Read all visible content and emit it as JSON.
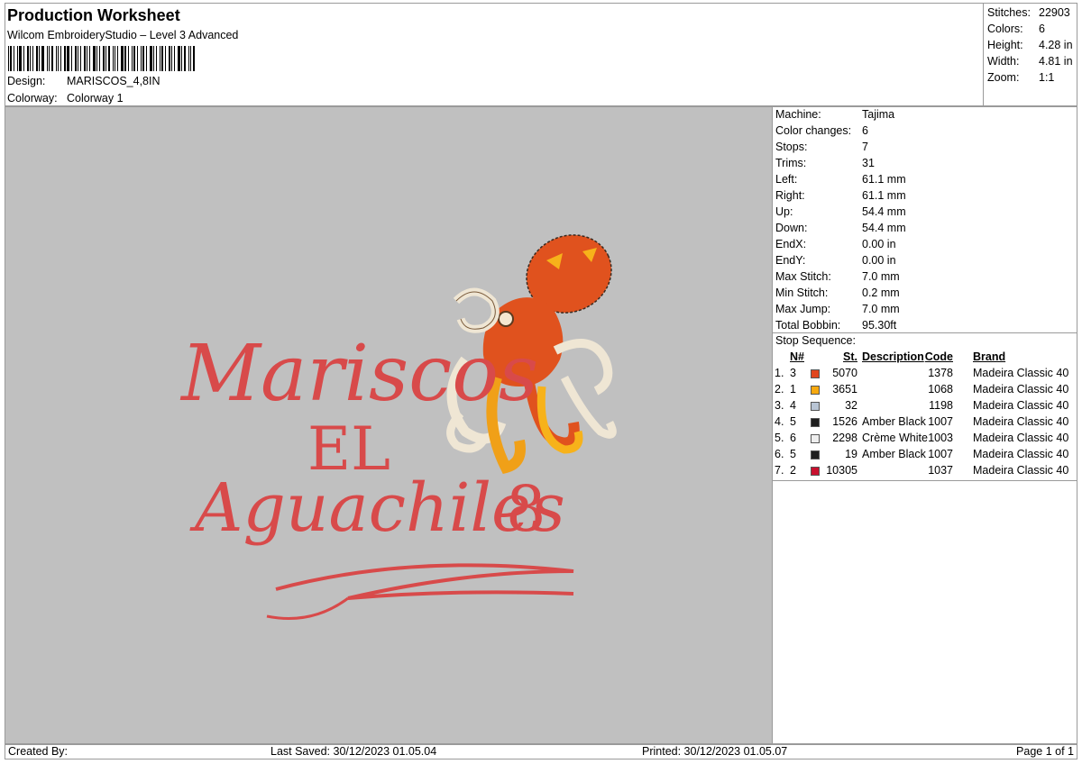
{
  "header": {
    "title": "Production Worksheet",
    "subtitle": "Wilcom EmbroideryStudio – Level 3 Advanced",
    "design_label": "Design:",
    "design_value": "MARISCOS_4,8IN",
    "colorway_label": "Colorway:",
    "colorway_value": "Colorway 1"
  },
  "summary": [
    {
      "label": "Stitches:",
      "value": "22903"
    },
    {
      "label": "Colors:",
      "value": "6"
    },
    {
      "label": "Height:",
      "value": "4.28 in"
    },
    {
      "label": "Width:",
      "value": "4.81 in"
    },
    {
      "label": "Zoom:",
      "value": "1:1"
    }
  ],
  "properties": [
    {
      "label": "Machine:",
      "value": "Tajima"
    },
    {
      "label": "Color changes:",
      "value": "6"
    },
    {
      "label": "Stops:",
      "value": "7"
    },
    {
      "label": "Trims:",
      "value": "31"
    },
    {
      "label": "Left:",
      "value": "61.1 mm"
    },
    {
      "label": "Right:",
      "value": "61.1 mm"
    },
    {
      "label": "Up:",
      "value": "54.4 mm"
    },
    {
      "label": "Down:",
      "value": "54.4 mm"
    },
    {
      "label": "EndX:",
      "value": "0.00 in"
    },
    {
      "label": "EndY:",
      "value": "0.00 in"
    },
    {
      "label": "Max Stitch:",
      "value": "7.0 mm"
    },
    {
      "label": "Min Stitch:",
      "value": "0.2 mm"
    },
    {
      "label": "Max Jump:",
      "value": "7.0 mm"
    },
    {
      "label": "Total Bobbin:",
      "value": "95.30ft"
    }
  ],
  "stop_sequence": {
    "title": "Stop Sequence:",
    "headers": {
      "n": "N#",
      "st": "St.",
      "description": "Description",
      "code": "Code",
      "brand": "Brand"
    },
    "rows": [
      {
        "idx": "1.",
        "n": "3",
        "color": "#e0461e",
        "st": "5070",
        "description": "",
        "code": "1378",
        "brand": "Madeira Classic 40"
      },
      {
        "idx": "2.",
        "n": "1",
        "color": "#f7a90f",
        "st": "3651",
        "description": "",
        "code": "1068",
        "brand": "Madeira Classic 40"
      },
      {
        "idx": "3.",
        "n": "4",
        "color": "#b8c4d4",
        "st": "32",
        "description": "",
        "code": "1198",
        "brand": "Madeira Classic 40"
      },
      {
        "idx": "4.",
        "n": "5",
        "color": "#1e1e1e",
        "st": "1526",
        "description": "Amber Black",
        "code": "1007",
        "brand": "Madeira Classic 40"
      },
      {
        "idx": "5.",
        "n": "6",
        "color": "#eeeeee",
        "st": "2298",
        "description": "Crème White",
        "code": "1003",
        "brand": "Madeira Classic 40"
      },
      {
        "idx": "6.",
        "n": "5",
        "color": "#1e1e1e",
        "st": "19",
        "description": "Amber Black",
        "code": "1007",
        "brand": "Madeira Classic 40"
      },
      {
        "idx": "7.",
        "n": "2",
        "color": "#c8102e",
        "st": "10305",
        "description": "",
        "code": "1037",
        "brand": "Madeira Classic 40"
      }
    ]
  },
  "preview": {
    "background": "#c0c0c0",
    "text_color": "#d84a4a",
    "line_1": "Mariscos",
    "line_2": "EL",
    "line_3": "Aguachiles",
    "number": "8"
  },
  "footer": {
    "created_by": "Created By:",
    "last_saved": "Last Saved: 30/12/2023 01.05.04",
    "printed": "Printed: 30/12/2023 01.05.07",
    "page": "Page 1 of 1"
  }
}
